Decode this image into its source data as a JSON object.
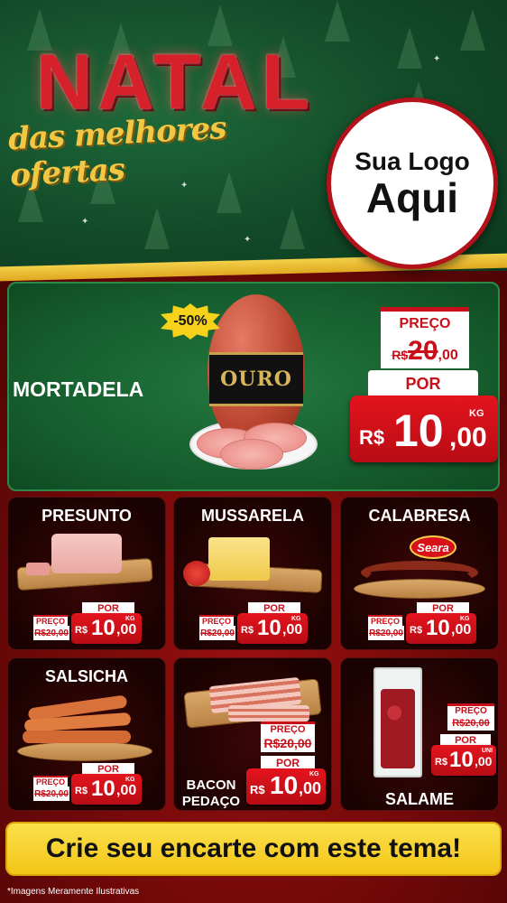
{
  "header": {
    "title": "NATAL",
    "subtitle": "das melhores ofertas",
    "logo_line1": "Sua Logo",
    "logo_line2": "Aqui"
  },
  "featured": {
    "name": "MORTADELA",
    "discount_badge": "-50%",
    "brand_label": "OURO",
    "price_label": "PREÇO",
    "old_currency": "R$",
    "old_price": "20",
    "old_cents": ",00",
    "por_label": "POR",
    "new_currency": "R$",
    "new_price": "10",
    "new_cents": ",00",
    "unit": "KG"
  },
  "products": [
    {
      "name": "PRESUNTO",
      "price_label": "PREÇO",
      "old_price": "R$20,00",
      "por_label": "POR",
      "currency": "R$",
      "price": "10",
      "cents": ",00",
      "unit": "KG"
    },
    {
      "name": "MUSSARELA",
      "price_label": "PREÇO",
      "old_price": "R$20,00",
      "por_label": "POR",
      "currency": "R$",
      "price": "10",
      "cents": ",00",
      "unit": "KG"
    },
    {
      "name": "CALABRESA",
      "brand": "Seara",
      "price_label": "PREÇO",
      "old_price": "R$20,00",
      "por_label": "POR",
      "currency": "R$",
      "price": "10",
      "cents": ",00",
      "unit": "KG"
    },
    {
      "name": "SALSICHA",
      "price_label": "PREÇO",
      "old_price": "R$20,00",
      "por_label": "POR",
      "currency": "R$",
      "price": "10",
      "cents": ",00",
      "unit": "KG"
    },
    {
      "name_line1": "BACON",
      "name_line2": "PEDAÇO",
      "price_label": "PREÇO",
      "old_price": "R$20,00",
      "por_label": "POR",
      "currency": "R$",
      "price": "10",
      "cents": ",00",
      "unit": "KG"
    },
    {
      "name": "SALAME",
      "price_label": "PREÇO",
      "old_price": "R$20,00",
      "por_label": "POR",
      "currency": "R$",
      "price": "10",
      "cents": ",00",
      "unit": "UNI"
    }
  ],
  "footer": {
    "cta": "Crie seu encarte com este tema!",
    "disclaimer": "*Imagens Meramente Ilustrativas"
  },
  "colors": {
    "header_green": "#124a28",
    "title_red": "#d6202a",
    "subtitle_gold": "#f2c744",
    "price_red": "#c8101a",
    "cta_yellow": "#f3c518",
    "featured_green": "#155a2c",
    "card_dark": "#1a0202"
  }
}
